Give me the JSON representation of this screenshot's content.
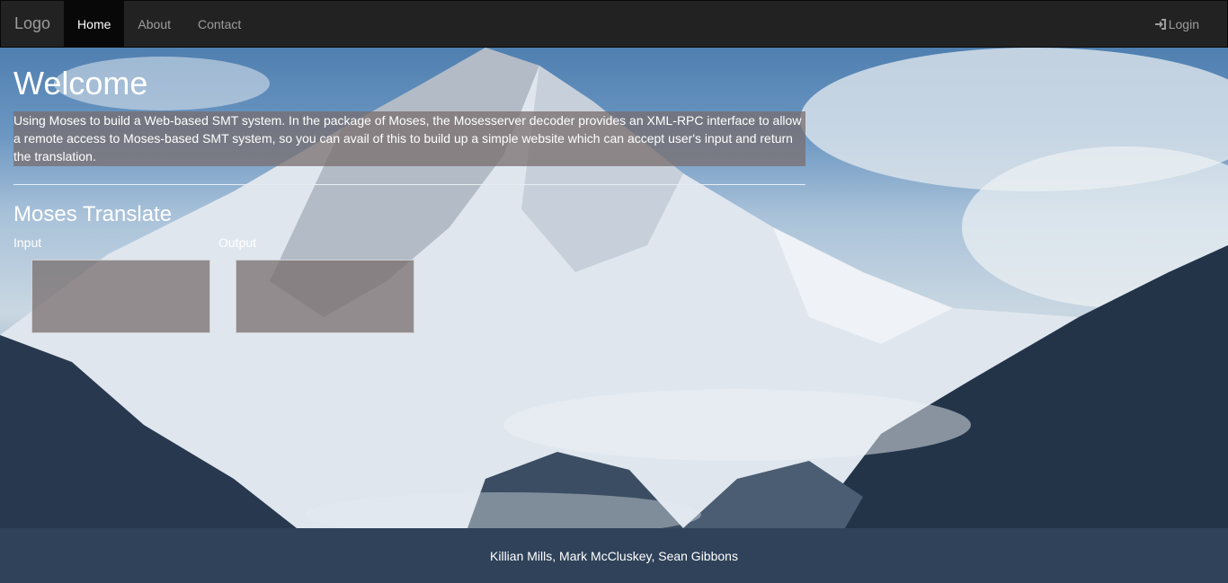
{
  "navbar": {
    "brand": "Logo",
    "items": [
      {
        "label": "Home",
        "active": true
      },
      {
        "label": "About",
        "active": false
      },
      {
        "label": "Contact",
        "active": false
      }
    ],
    "login_label": "Login",
    "login_icon": "log-in-icon"
  },
  "main": {
    "title": "Welcome",
    "intro": "Using Moses to build a Web-based SMT system. In the package of Moses, the Mosesserver decoder provides an XML-RPC interface to allow a remote access to Moses-based SMT system, so you can avail of this to build up a simple website which can accept user's input and return the translation.",
    "section_title": "Moses Translate",
    "input_label": "Input",
    "output_label": "Output",
    "input_value": "",
    "output_value": ""
  },
  "footer": {
    "text": "Killian Mills, Mark McCluskey, Sean Gibbons"
  },
  "colors": {
    "navbar_bg": "#222222",
    "nav_active_bg": "#080808",
    "footer_bg": "#2f425a",
    "panel_bg": "rgba(120,110,110,0.75)"
  }
}
